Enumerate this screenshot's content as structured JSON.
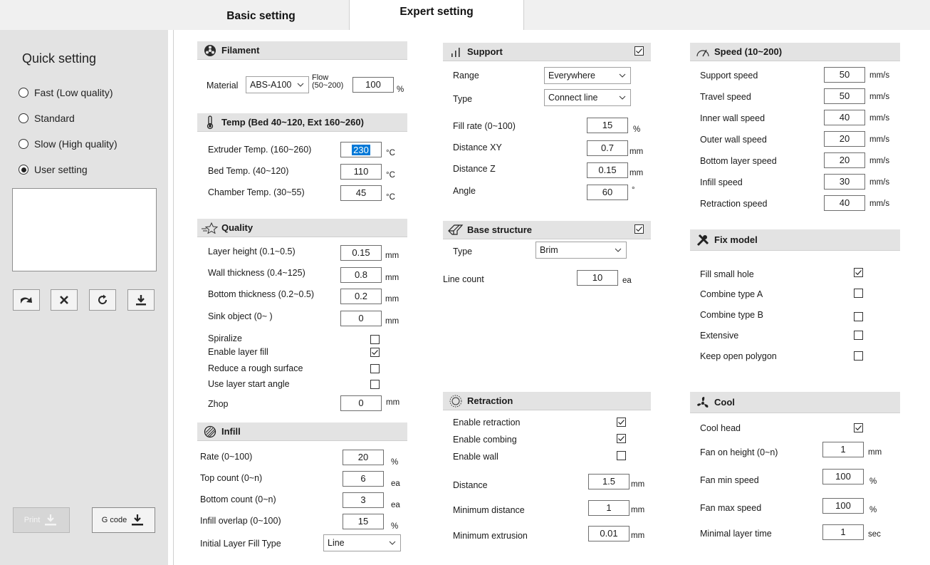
{
  "tabs": {
    "basic": "Basic setting",
    "expert": "Expert setting"
  },
  "sidebar": {
    "title": "Quick setting",
    "options": [
      {
        "label": "Fast (Low quality)",
        "checked": false
      },
      {
        "label": "Standard",
        "checked": false
      },
      {
        "label": "Slow (High quality)",
        "checked": false
      },
      {
        "label": "User setting",
        "checked": true
      }
    ],
    "toolbar_icons": [
      "redo-arrow-icon",
      "close-x-icon",
      "refresh-icon",
      "download-icon"
    ],
    "print_label": "Print",
    "gcode_label": "G code"
  },
  "filament": {
    "title": "Filament",
    "material_label": "Material",
    "material_value": "ABS-A100",
    "flow_label_1": "Flow",
    "flow_label_2": "(50~200)",
    "flow_value": "100",
    "flow_unit": "%"
  },
  "temp": {
    "title": "Temp (Bed 40~120, Ext 160~260)",
    "rows": [
      {
        "label": "Extruder Temp. (160~260)",
        "value": "230",
        "unit": "°C"
      },
      {
        "label": "Bed Temp. (40~120)",
        "value": "110",
        "unit": "°C"
      },
      {
        "label": "Chamber Temp. (30~55)",
        "value": "45",
        "unit": "°C"
      }
    ]
  },
  "quality": {
    "title": "Quality",
    "rows": [
      {
        "label": "Layer height (0.1~0.5)",
        "value": "0.15",
        "unit": "mm"
      },
      {
        "label": "Wall thickness (0.4~125)",
        "value": "0.8",
        "unit": "mm"
      },
      {
        "label": "Bottom thickness (0.2~0.5)",
        "value": "0.2",
        "unit": "mm"
      },
      {
        "label": "Sink object (0~ )",
        "value": "0",
        "unit": "mm"
      }
    ],
    "checks": [
      {
        "label": "Spiralize",
        "checked": false
      },
      {
        "label": "Enable layer fill",
        "checked": true
      },
      {
        "label": "Reduce a rough surface",
        "checked": false
      },
      {
        "label": "Use layer start angle",
        "checked": false
      }
    ],
    "zhop_label": "Zhop",
    "zhop_value": "0",
    "zhop_unit": "mm"
  },
  "infill": {
    "title": "Infill",
    "rows": [
      {
        "label": "Rate (0~100)",
        "value": "20",
        "unit": "%"
      },
      {
        "label": "Top count (0~n)",
        "value": "6",
        "unit": "ea"
      },
      {
        "label": "Bottom count (0~n)",
        "value": "3",
        "unit": "ea"
      },
      {
        "label": "Infill overlap (0~100)",
        "value": "15",
        "unit": "%"
      }
    ],
    "fill_type_label": "Initial Layer Fill Type",
    "fill_type_value": "Line"
  },
  "support": {
    "title": "Support",
    "enabled": true,
    "range_label": "Range",
    "range_value": "Everywhere",
    "type_label": "Type",
    "type_value": "Connect line",
    "rows": [
      {
        "label": "Fill rate (0~100)",
        "value": "15",
        "unit": "%"
      },
      {
        "label": "Distance XY",
        "value": "0.7",
        "unit": "mm"
      },
      {
        "label": "Distance Z",
        "value": "0.15",
        "unit": "mm"
      },
      {
        "label": "Angle",
        "value": "60",
        "unit": "°"
      }
    ]
  },
  "base": {
    "title": "Base structure",
    "enabled": true,
    "type_label": "Type",
    "type_value": "Brim",
    "line_count_label": "Line count",
    "line_count_value": "10",
    "line_count_unit": "ea"
  },
  "retraction": {
    "title": "Retraction",
    "checks": [
      {
        "label": "Enable retraction",
        "checked": true
      },
      {
        "label": "Enable combing",
        "checked": true
      },
      {
        "label": "Enable wall",
        "checked": false
      }
    ],
    "rows": [
      {
        "label": "Distance",
        "value": "1.5",
        "unit": "mm"
      },
      {
        "label": "Minimum distance",
        "value": "1",
        "unit": "mm"
      },
      {
        "label": "Minimum extrusion",
        "value": "0.01",
        "unit": "mm"
      }
    ]
  },
  "speed": {
    "title": "Speed (10~200)",
    "rows": [
      {
        "label": "Support speed",
        "value": "50",
        "unit": "mm/s"
      },
      {
        "label": "Travel speed",
        "value": "50",
        "unit": "mm/s"
      },
      {
        "label": "Inner wall speed",
        "value": "40",
        "unit": "mm/s"
      },
      {
        "label": "Outer wall speed",
        "value": "20",
        "unit": "mm/s"
      },
      {
        "label": "Bottom layer speed",
        "value": "20",
        "unit": "mm/s"
      },
      {
        "label": "Infill speed",
        "value": "30",
        "unit": "mm/s"
      },
      {
        "label": "Retraction speed",
        "value": "40",
        "unit": "mm/s"
      }
    ]
  },
  "fix": {
    "title": "Fix model",
    "checks": [
      {
        "label": "Fill small hole",
        "checked": true
      },
      {
        "label": "Combine type A",
        "checked": false
      },
      {
        "label": "Combine type B",
        "checked": false
      },
      {
        "label": "Extensive",
        "checked": false
      },
      {
        "label": "Keep open polygon",
        "checked": false
      }
    ]
  },
  "cool": {
    "title": "Cool",
    "cool_head_label": "Cool head",
    "cool_head_checked": true,
    "rows": [
      {
        "label": "Fan on height (0~n)",
        "value": "1",
        "unit": "mm"
      },
      {
        "label": "Fan min speed",
        "value": "100",
        "unit": "%"
      },
      {
        "label": "Fan max speed",
        "value": "100",
        "unit": "%"
      },
      {
        "label": "Minimal layer time",
        "value": "1",
        "unit": "sec"
      }
    ]
  }
}
